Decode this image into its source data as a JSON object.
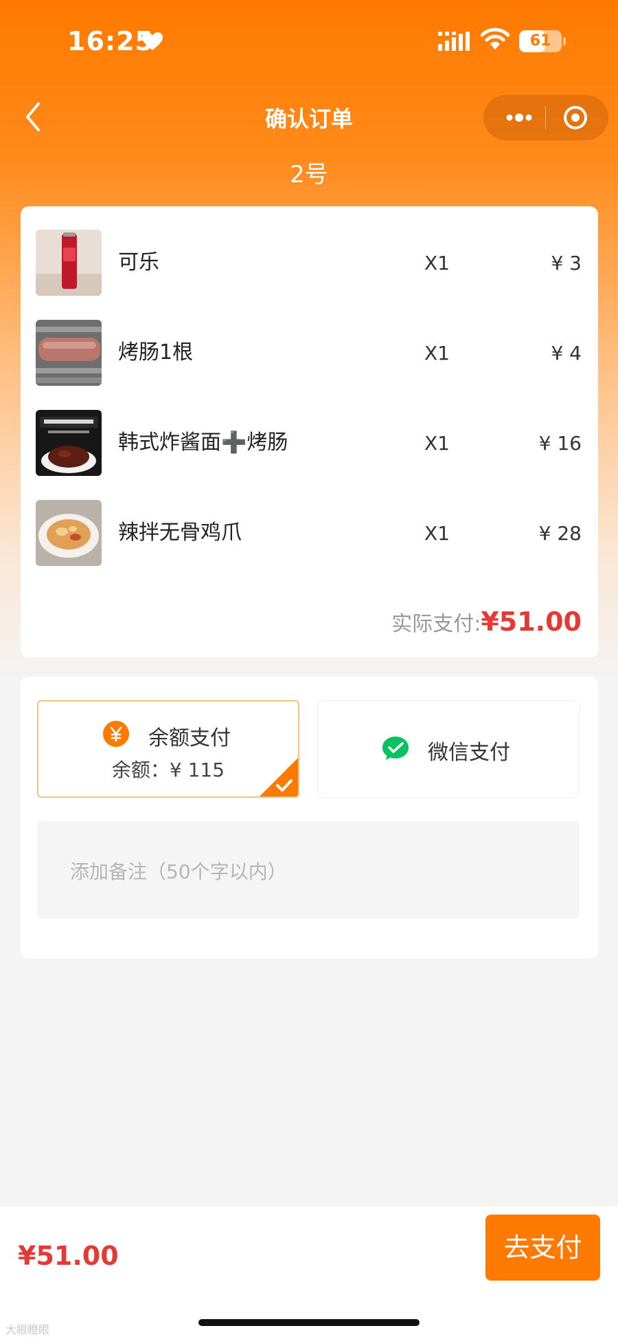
{
  "status_bar": {
    "time": "16:25",
    "battery": "61",
    "battery_level": 0.61
  },
  "nav": {
    "title": "确认订单",
    "subtitle": "2号"
  },
  "order": {
    "items": [
      {
        "name": "可乐",
        "qty": "X1",
        "price": "¥ 3"
      },
      {
        "name": "烤肠1根",
        "qty": "X1",
        "price": "¥ 4"
      },
      {
        "name": "韩式炸酱面➕烤肠",
        "qty": "X1",
        "price": "¥ 16"
      },
      {
        "name": "辣拌无骨鸡爪",
        "qty": "X1",
        "price": "¥ 28"
      }
    ],
    "total_label": "实际支付:",
    "total_value": "¥51.00"
  },
  "payment": {
    "balance_label": "余额支付",
    "balance_amount": "余额：¥ 115",
    "wechat_label": "微信支付",
    "selected": "balance",
    "remark_placeholder": "添加备注（50个字以内）"
  },
  "bottom": {
    "total": "¥51.00",
    "pay_button": "去支付"
  },
  "watermark": "大眼瞪眼",
  "colors": {
    "accent": "#ff7a00",
    "price_red": "#e53935",
    "wechat_green": "#07c160"
  }
}
